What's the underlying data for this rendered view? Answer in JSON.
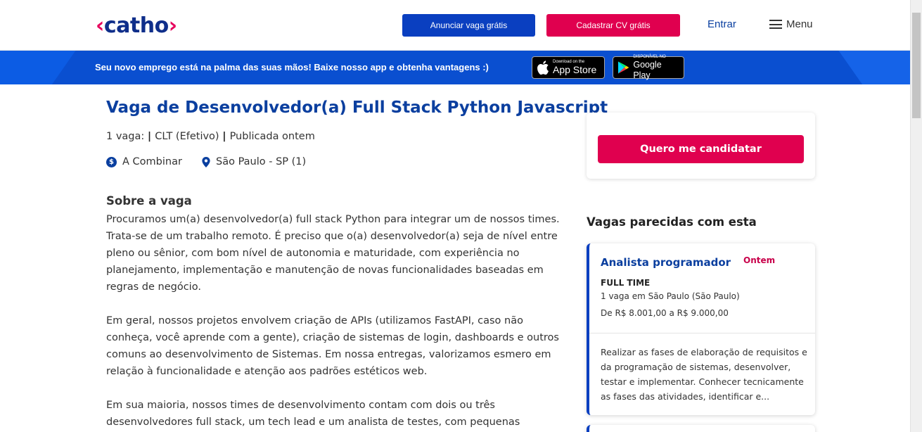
{
  "header": {
    "logo_text": "catho",
    "anunciar_label": "Anunciar vaga grátis",
    "cadastrar_label": "Cadastrar CV grátis",
    "entrar_label": "Entrar",
    "menu_label": "Menu"
  },
  "banner": {
    "text": "Seu novo emprego está na palma das suas mãos! Baixe nosso app e obtenha vantagens :)",
    "appstore_small": "Download on the",
    "appstore_big": "App Store",
    "googleplay_small": "DISPONÍVEL NO",
    "googleplay_big": "Google Play"
  },
  "job": {
    "title": "Vaga de Desenvolvedor(a) Full Stack Python Javascript",
    "vagas": "1 vaga:",
    "contrato": "CLT (Efetivo)",
    "publicada": "Publicada ontem",
    "salary": "A Combinar",
    "location": "São Paulo - SP (1)",
    "section_title": "Sobre a vaga",
    "paragraph_1": "Procuramos um(a) desenvolvedor(a) full stack Python para integrar um de nossos times. Trata-se de um trabalho remoto. É preciso que o(a) desenvolvedor(a) seja de nível entre pleno ou sênior, com bom nível de autonomia e maturidade, com experiência no planejamento, implementação e manutenção de novas funcionalidades baseadas em regras de negócio.",
    "paragraph_2": "Em geral, nossos projetos envolvem criação de APIs (utilizamos FastAPI, caso não conheça, você aprende com a gente), criação de sistemas de login, dashboards e outros comuns ao desenvolvimento de Sistemas. Em nossa entregas, valorizamos esmero em relação à funcionalidade e atenção aos padrões estéticos web.",
    "paragraph_3": "Em sua maioria, nossos times de desenvolvimento contam com dois ou três desenvolvedores full stack, um tech lead e um analista de testes, com pequenas"
  },
  "sidebar": {
    "apply_label": "Quero me candidatar",
    "similar_title": "Vagas parecidas com esta",
    "similar_jobs": [
      {
        "title": "Analista programador",
        "date": "Ontem",
        "type": "FULL TIME",
        "location": "1 vaga em São Paulo (São Paulo)",
        "salary": "De R$ 8.001,00 a R$ 9.000,00",
        "snippet": "Realizar as fases de elaboração de requisitos e da programação de sistemas, desenvolver, testar e implementar. Conhecer tecnicamente as fases das atividades, identificar e..."
      }
    ]
  },
  "icons": {
    "salary": "dollar-circle-icon",
    "location": "map-pin-icon",
    "menu": "hamburger-icon",
    "apple": "apple-icon",
    "google_play": "play-triangle-icon"
  },
  "colors": {
    "primary_blue": "#0a3fc0",
    "banner_blue": "#0a4fd0",
    "accent_pink": "#e0004f",
    "title_blue": "#0b3f9f"
  }
}
